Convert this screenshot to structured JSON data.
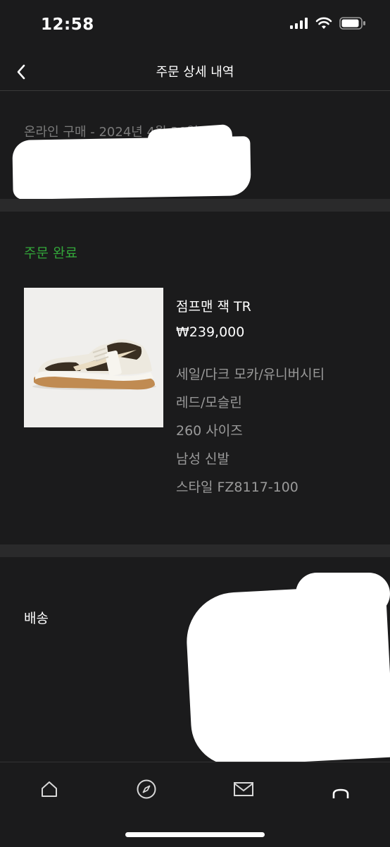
{
  "status_bar": {
    "time": "12:58"
  },
  "header": {
    "title": "주문 상세 내역"
  },
  "purchase": {
    "info": "온라인 구매 - 2024년 4월 30일"
  },
  "order": {
    "status": "주문 완료",
    "status_color": "#33a63a",
    "product": {
      "name": "점프맨 잭 TR",
      "price": "₩239,000",
      "details": [
        "세일/다크 모카/유니버시티",
        "레드/모슬린",
        "260 사이즈",
        "남성 신발",
        "스타일 FZ8117-100"
      ]
    }
  },
  "delivery": {
    "title": "배송"
  },
  "tab_bar": {
    "tabs": [
      {
        "icon": "home-icon"
      },
      {
        "icon": "compass-icon"
      },
      {
        "icon": "mail-icon"
      },
      {
        "icon": "profile-icon"
      }
    ]
  }
}
